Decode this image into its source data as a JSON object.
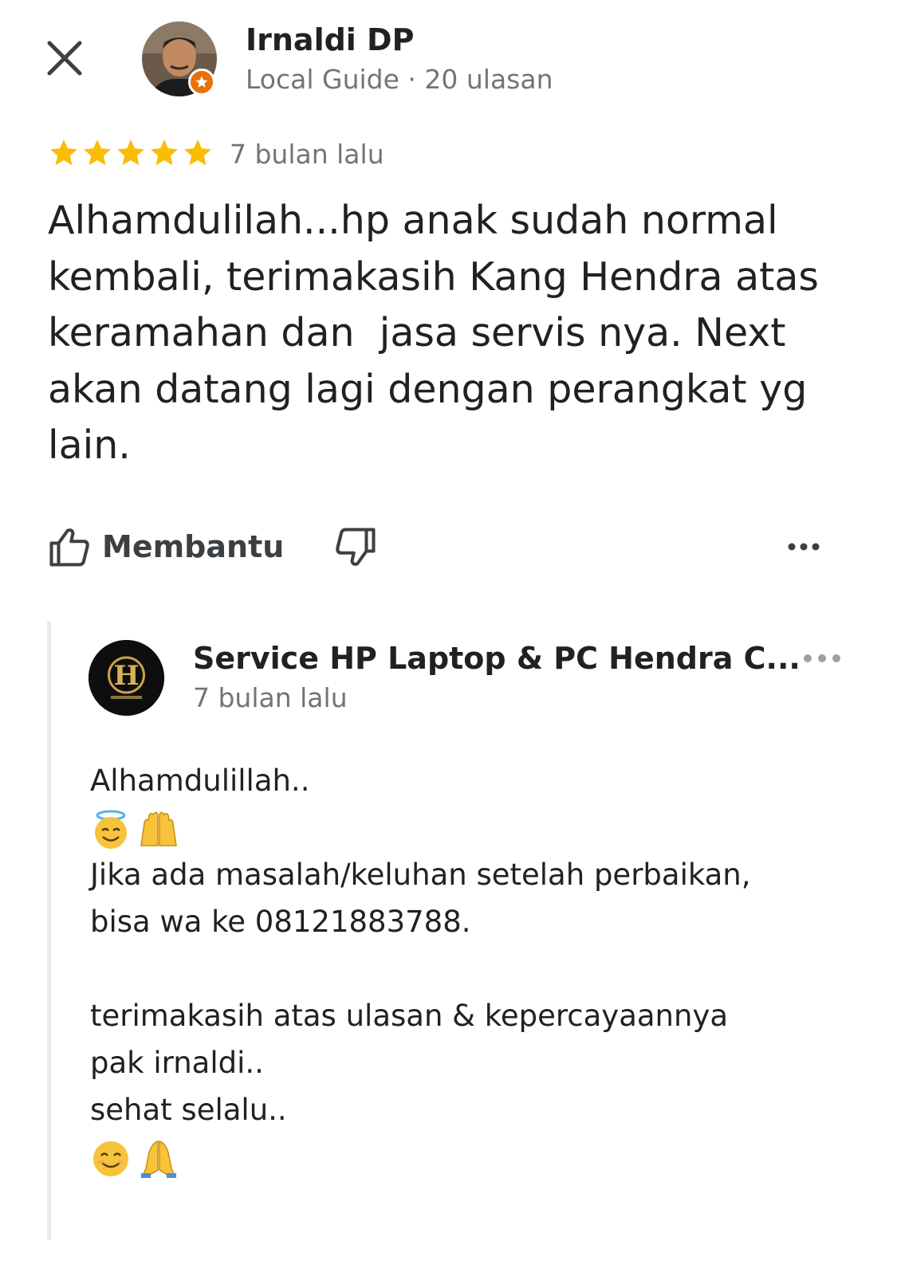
{
  "header": {
    "close_icon": "close-icon",
    "user_name": "Irnaldi DP",
    "user_meta": "Local Guide · 20 ulasan",
    "badge_icon": "local-guide-star-icon",
    "badge_color": "#e8710a"
  },
  "review": {
    "rating": 5,
    "rating_max": 5,
    "star_color": "#fbbc04",
    "time": "7 bulan lalu",
    "text": "Alhamdulilah...hp anak sudah normal\nkembali, terimakasih Kang Hendra atas\nkeramahan dan  jasa servis nya. Next\nakan datang lagi dengan perangkat yg\nlain."
  },
  "actions": {
    "like_label": "Membantu",
    "like_icon": "thumb-up-icon",
    "dislike_icon": "thumb-down-icon",
    "more_icon": "more-horizontal-icon"
  },
  "reply": {
    "owner_name": "Service HP Laptop & PC Hendra C...",
    "owner_logo_letter": "H",
    "time": "7 bulan lalu",
    "line1": "Alhamdulillah..",
    "emoji1": [
      "smiling-face-with-halo-emoji",
      "raising-hands-emoji"
    ],
    "line2": "\nJika ada masalah/keluhan setelah perbaikan,\nbisa wa ke 08121883788.\n\nterimakasih atas ulasan & kepercayaannya\npak irnaldi..\nsehat selalu..",
    "emoji2": [
      "smiling-face-emoji",
      "folded-hands-emoji"
    ]
  }
}
